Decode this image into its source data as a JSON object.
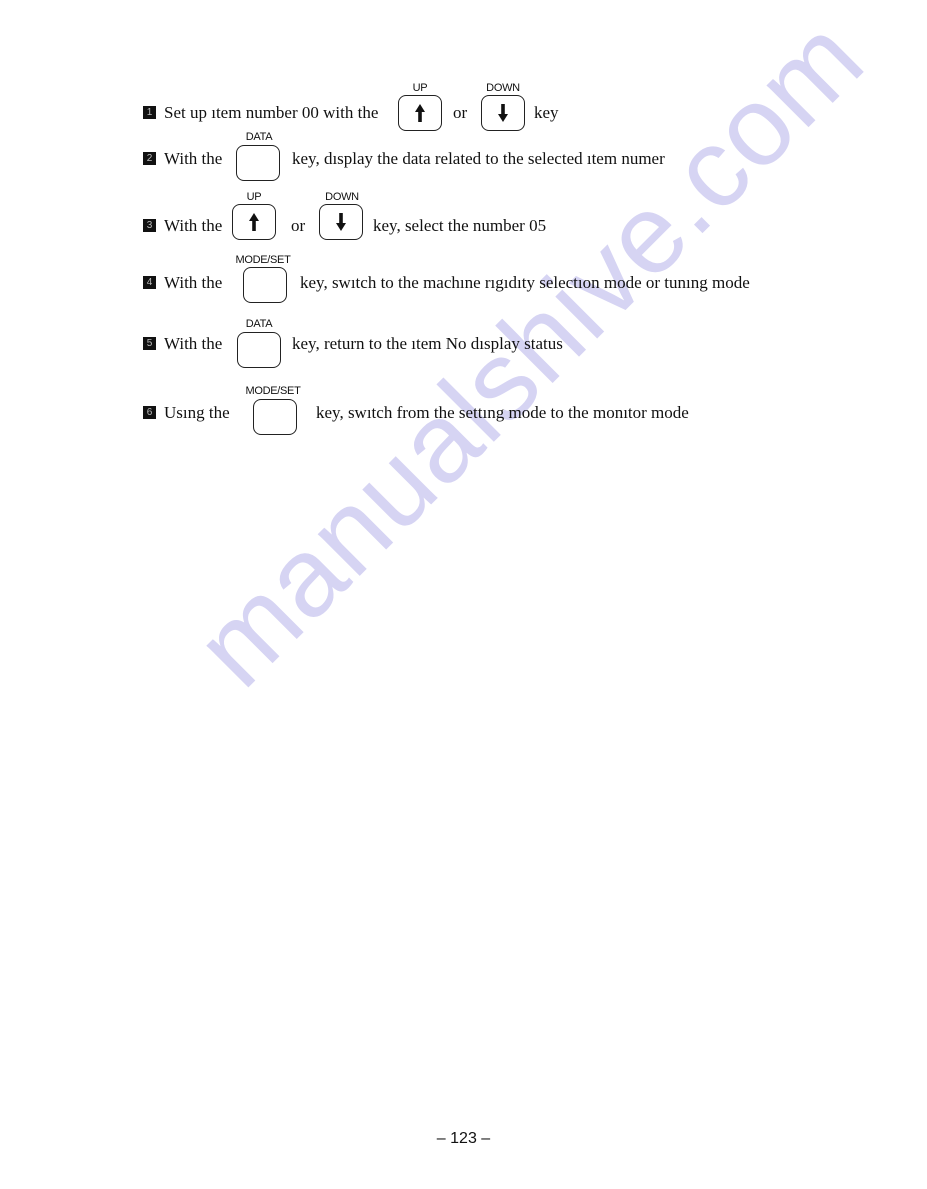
{
  "watermark": "manualshive.com",
  "steps": [
    {
      "number": "1",
      "before": "Set up ıtem number 00 with the",
      "key1_label": "UP",
      "key1_icon": "up-arrow-icon",
      "between": "or",
      "key2_label": "DOWN",
      "key2_icon": "down-arrow-icon",
      "after": "key"
    },
    {
      "number": "2",
      "before": "With the",
      "key_label": "DATA",
      "after": "key, dısplay the data related to the selected ıtem numer"
    },
    {
      "number": "3",
      "before": "With the",
      "key1_label": "UP",
      "key1_icon": "up-arrow-icon",
      "between": "or",
      "key2_label": "DOWN",
      "key2_icon": "down-arrow-icon",
      "after": "key, select the number 05"
    },
    {
      "number": "4",
      "before": "With the",
      "key_label": "MODE/SET",
      "after": "key, swıtch to the machıne rıgıdıty selectıon mode or tunıng mode"
    },
    {
      "number": "5",
      "before": "With the",
      "key_label": "DATA",
      "after": "key, return to the ıtem No  dısplay status"
    },
    {
      "number": "6",
      "before": "Usıng the",
      "key_label": "MODE/SET",
      "after": "key, swıtch from the settıng mode to the monıtor mode"
    }
  ],
  "page_number": "– 123 –"
}
